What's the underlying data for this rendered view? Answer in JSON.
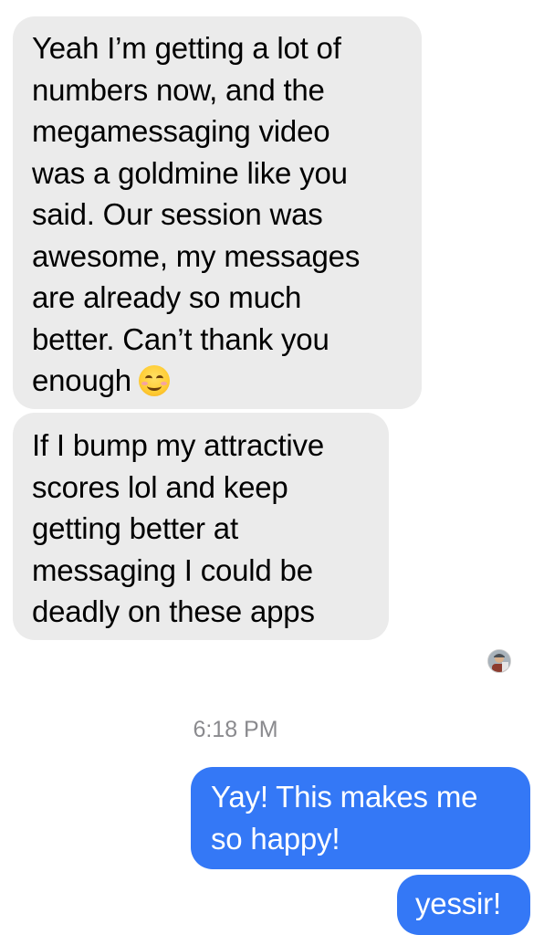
{
  "conversation": {
    "incoming_messages": [
      {
        "lines": [
          "Yeah I’m getting a lot of",
          "numbers now, and the",
          "megamessaging video",
          "was a goldmine like you",
          "said. Our session was",
          "awesome, my messages",
          "are already so much",
          "better. Can’t thank you",
          "enough"
        ],
        "emoji": "smiling-face-with-smiling-eyes"
      },
      {
        "lines": [
          "If I bump my attractive",
          "scores lol and keep",
          "getting better at",
          "messaging I could be",
          "deadly on these apps"
        ]
      }
    ],
    "contact_avatar": "contact-avatar",
    "timestamp": "6:18 PM",
    "outgoing_messages": [
      {
        "lines": [
          "Yay! This makes me",
          "so happy!"
        ]
      },
      {
        "lines": [
          "yessir!"
        ]
      }
    ]
  },
  "colors": {
    "incoming_bubble": "#ebebeb",
    "outgoing_bubble": "#3478f6",
    "timestamp_text": "#8a8a8e"
  }
}
